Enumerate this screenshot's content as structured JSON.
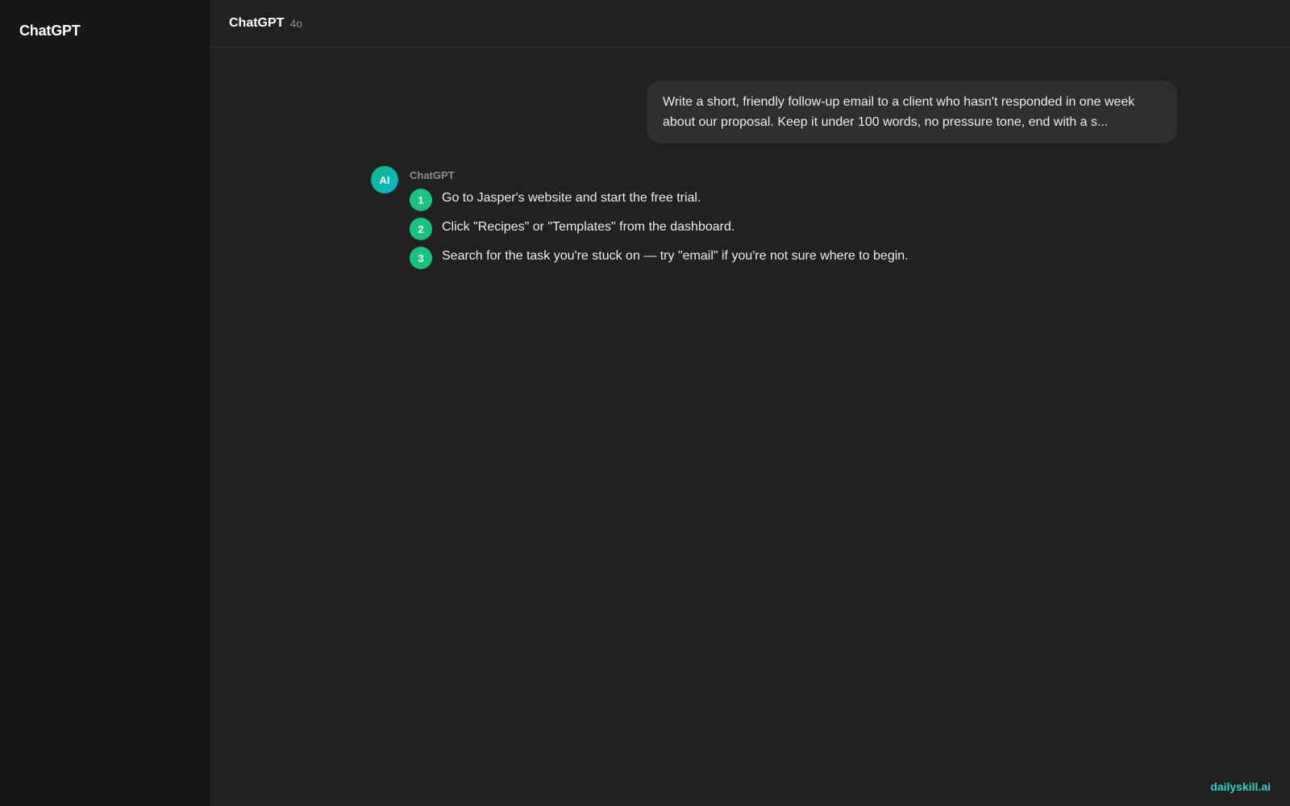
{
  "sidebar": {
    "brand": "ChatGPT"
  },
  "header": {
    "model_name": "ChatGPT",
    "model_version": "4o"
  },
  "conversation": {
    "user_message": "Write a short, friendly follow-up email to a client who hasn't responded in one week about our proposal. Keep it under 100 words, no pressure tone, end with a s...",
    "assistant": {
      "avatar_label": "AI",
      "name": "ChatGPT",
      "steps": [
        {
          "num": "1",
          "text": "Go to Jasper's website and start the free trial."
        },
        {
          "num": "2",
          "text": "Click \"Recipes\" or \"Templates\" from the dashboard."
        },
        {
          "num": "3",
          "text": "Search for the task you're stuck on — try \"email\" if you're not sure where to begin."
        }
      ]
    }
  },
  "watermark": "dailyskill.ai",
  "colors": {
    "sidebar_bg": "#171717",
    "main_bg": "#212121",
    "bubble_bg": "#2f2f2f",
    "step_accent": "#19c37d",
    "watermark": "#2dd4bf"
  }
}
